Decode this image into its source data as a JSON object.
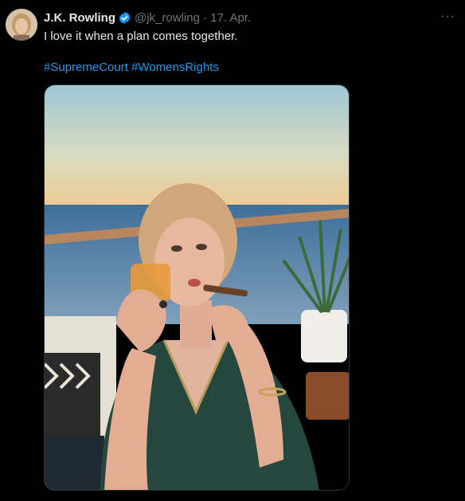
{
  "tweet": {
    "author_name": "J.K. Rowling",
    "handle_and_date": "@jk_rowling · 17. Apr.",
    "text": "I love it when a plan comes together.",
    "hashtags": [
      "#SupremeCourt",
      "#WomensRights"
    ],
    "more_label": "···"
  },
  "colors": {
    "background": "#000000",
    "text": "#e7e9ea",
    "secondary_text": "#71767b",
    "link": "#1d9bf0",
    "verified": "#1d9bf0"
  },
  "icons": {
    "verified": "verified-badge-icon",
    "more": "more-dots-icon"
  }
}
